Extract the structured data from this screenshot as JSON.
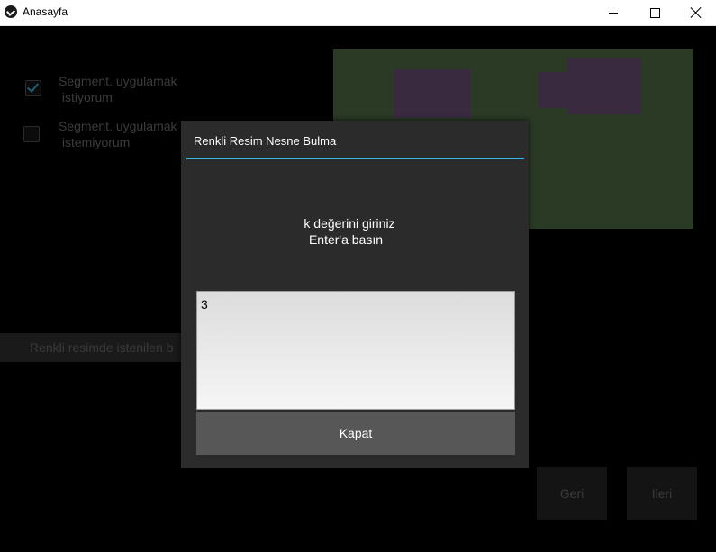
{
  "window": {
    "title": "Anasayfa",
    "icon": "kivy-logo-icon"
  },
  "options": [
    {
      "label": "Segment. uygulamak\n istiyorum",
      "checked": true
    },
    {
      "label": "Segment. uygulamak\n istemiyorum",
      "checked": false
    }
  ],
  "background_field_text": "Renkli resimde istenilen b",
  "nav": {
    "back_label": "Geri",
    "next_label": "Ileri"
  },
  "popup": {
    "title": "Renkli Resim Nesne Bulma",
    "message_line1": "k değerini giriniz",
    "message_line2": "Enter'a basın",
    "input_value": "3",
    "close_label": "Kapat"
  },
  "colors": {
    "accent": "#34b5e5",
    "popup_bg": "#2b2b2b",
    "button_bg": "#575757",
    "image_bg": "#2a3a24",
    "blob": "#3a2a40"
  }
}
